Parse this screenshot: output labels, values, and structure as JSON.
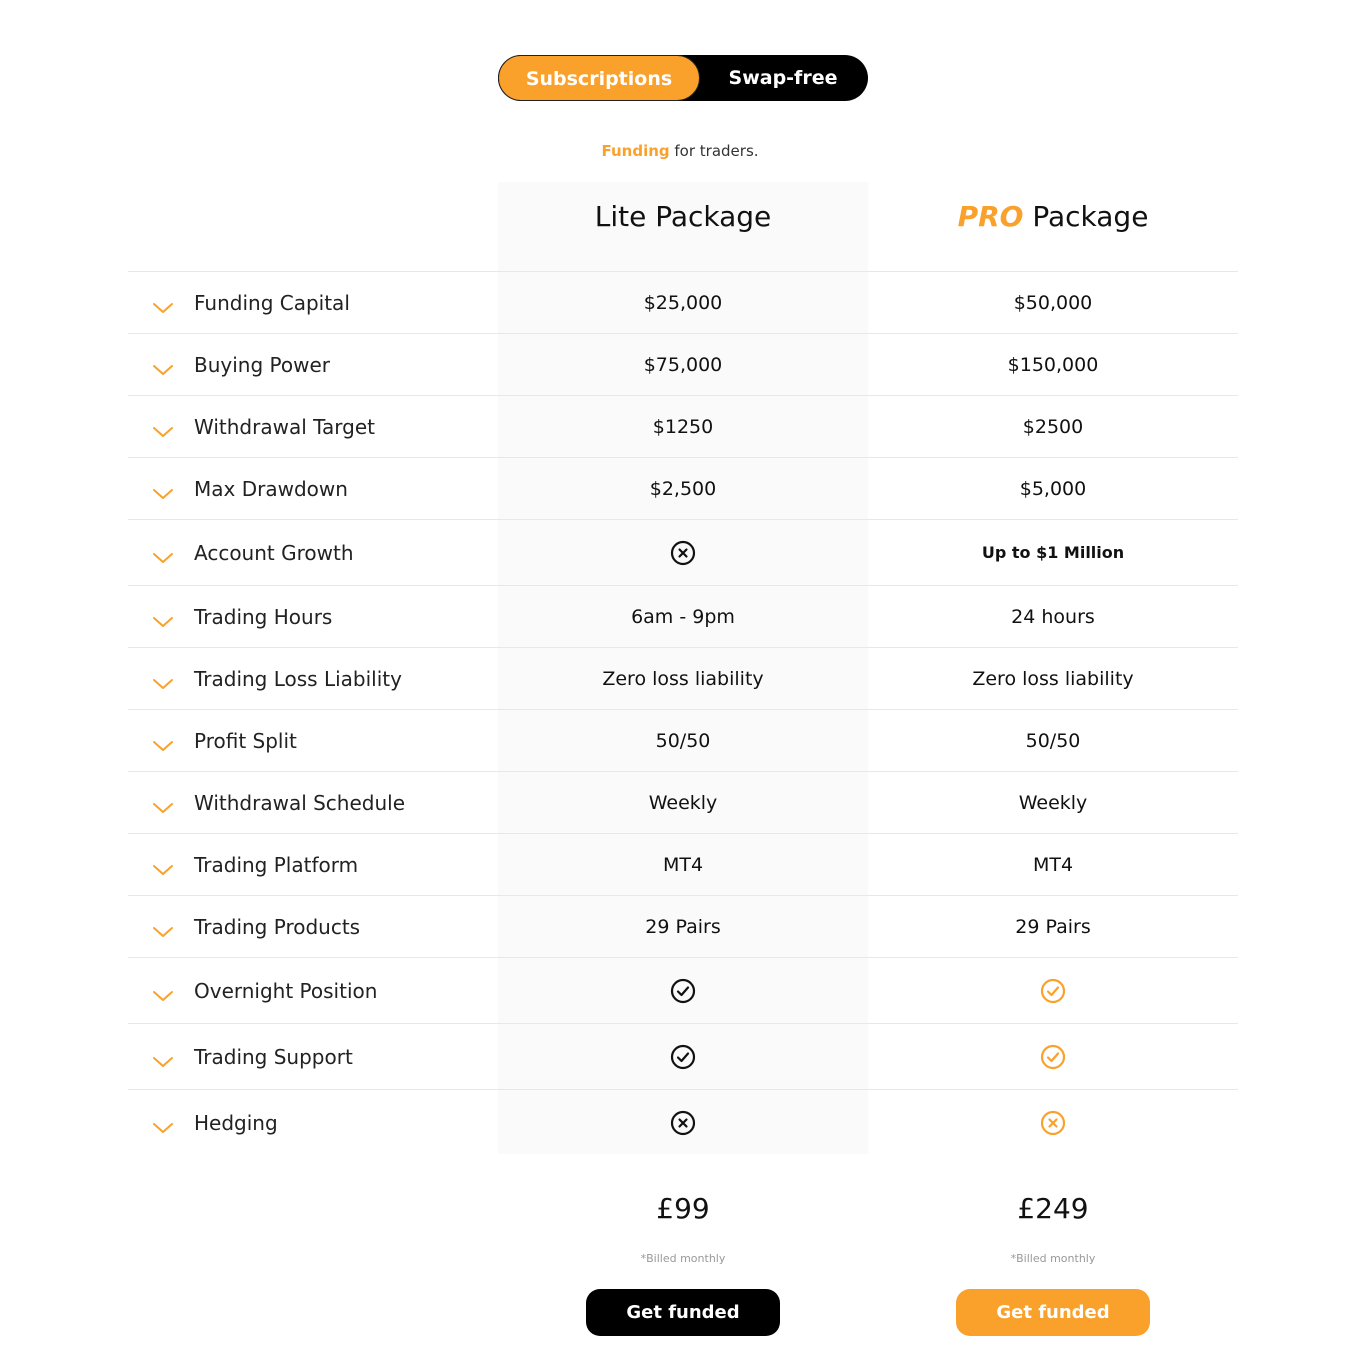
{
  "toggle": {
    "active": "Subscriptions",
    "inactive": "Swap-free"
  },
  "tagline": {
    "accent": "Funding",
    "rest": " for traders."
  },
  "packages": {
    "lite": {
      "title": "Lite Package",
      "price": "£99",
      "billed": "*Billed monthly",
      "cta": "Get funded"
    },
    "pro": {
      "title_accent": "PRO",
      "title_rest": " Package",
      "price": "£249",
      "billed": "*Billed monthly",
      "cta": "Get funded"
    }
  },
  "colors": {
    "accent": "#f9a12b",
    "dark": "#000000",
    "lite_bg": "#fafafa"
  },
  "rows": [
    {
      "label": "Funding Capital",
      "lite": "$25,000",
      "pro": "$50,000"
    },
    {
      "label": "Buying Power",
      "lite": "$75,000",
      "pro": "$150,000"
    },
    {
      "label": "Withdrawal Target",
      "lite": "$1250",
      "pro": "$2500"
    },
    {
      "label": "Max Drawdown",
      "lite": "$2,500",
      "pro": "$5,000"
    },
    {
      "label": "Account Growth",
      "lite_icon": "x-circle-icon",
      "pro": "Up to $1 Million"
    },
    {
      "label": "Trading Hours",
      "lite": "6am - 9pm",
      "pro": "24 hours"
    },
    {
      "label": "Trading Loss Liability",
      "lite": "Zero loss liability",
      "pro": "Zero loss liability"
    },
    {
      "label": "Profit Split",
      "lite": "50/50",
      "pro": "50/50"
    },
    {
      "label": "Withdrawal Schedule",
      "lite": "Weekly",
      "pro": "Weekly"
    },
    {
      "label": "Trading Platform",
      "lite": "MT4",
      "pro": "MT4"
    },
    {
      "label": "Trading Products",
      "lite": "29 Pairs",
      "pro": "29 Pairs"
    },
    {
      "label": "Overnight Position",
      "lite_icon": "check-circle-icon",
      "pro_icon": "check-circle-icon"
    },
    {
      "label": "Trading Support",
      "lite_icon": "check-circle-icon",
      "pro_icon": "check-circle-icon"
    },
    {
      "label": "Hedging",
      "lite_icon": "x-circle-icon",
      "pro_icon": "x-circle-icon"
    }
  ]
}
